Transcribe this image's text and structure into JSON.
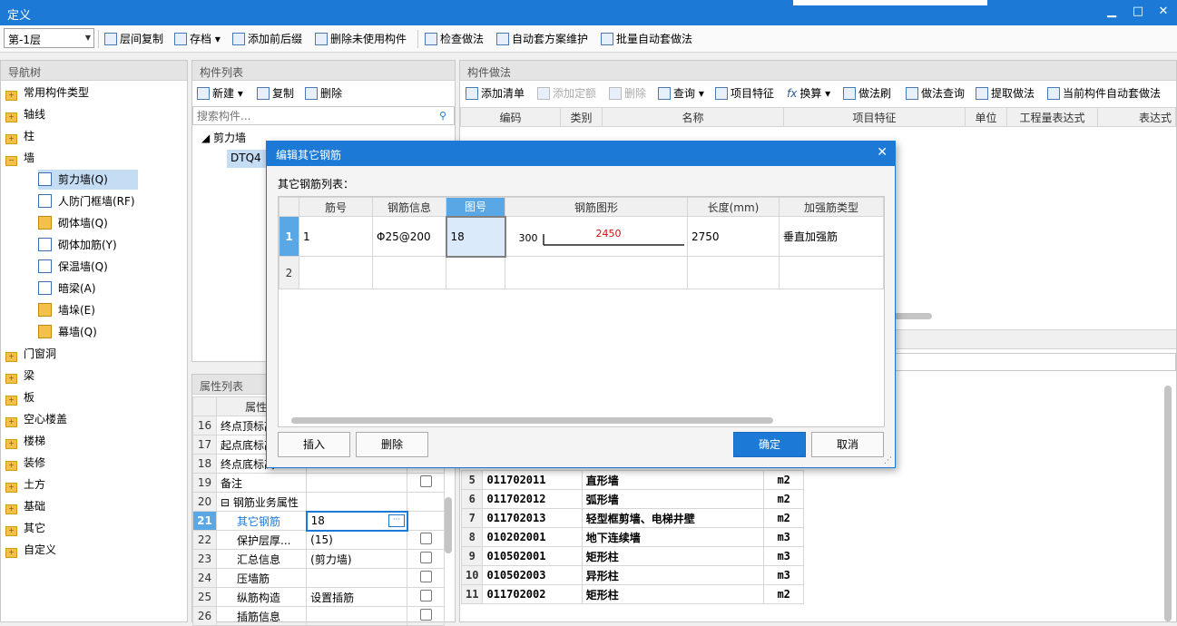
{
  "window": {
    "title": "定义"
  },
  "toolbar": {
    "floor": "第-1层",
    "items": [
      "层间复制",
      "存档",
      "添加前后缀",
      "删除未使用构件",
      "检查做法",
      "自动套方案维护",
      "批量自动套做法"
    ]
  },
  "nav": {
    "title": "导航树",
    "items": [
      "常用构件类型",
      "轴线",
      "柱",
      "墙",
      "梁",
      "板",
      "空心楼盖",
      "楼梯",
      "装修",
      "土方",
      "基础",
      "其它",
      "自定义"
    ],
    "door": "门窗洞",
    "wall_children": [
      "剪力墙(Q)",
      "人防门框墙(RF)",
      "砌体墙(Q)",
      "砌体加筋(Y)",
      "保温墙(Q)",
      "暗梁(A)",
      "墙垛(E)",
      "幕墙(Q)"
    ]
  },
  "complist": {
    "title": "构件列表",
    "new": "新建",
    "copy": "复制",
    "delete": "删除",
    "search_placeholder": "搜索构件...",
    "group": "剪力墙",
    "item": "DTQ4"
  },
  "props": {
    "title": "属性列表",
    "col": "属性名",
    "rows": [
      {
        "n": "16",
        "name": "终点顶标高",
        "val": "",
        "chk": false
      },
      {
        "n": "17",
        "name": "起点底标高",
        "val": "",
        "chk": false
      },
      {
        "n": "18",
        "name": "终点底标高",
        "val": "",
        "chk": false
      },
      {
        "n": "19",
        "name": "备注",
        "val": "",
        "chk": true
      },
      {
        "n": "20",
        "name": "钢筋业务属性",
        "val": "",
        "chk": null
      },
      {
        "n": "21",
        "name": "其它钢筋",
        "val": "18",
        "chk": null
      },
      {
        "n": "22",
        "name": "保护层厚...",
        "val": "(15)",
        "chk": true
      },
      {
        "n": "23",
        "name": "汇总信息",
        "val": "(剪力墙)",
        "chk": true
      },
      {
        "n": "24",
        "name": "压墙筋",
        "val": "",
        "chk": true
      },
      {
        "n": "25",
        "name": "纵筋构造",
        "val": "设置插筋",
        "chk": true
      },
      {
        "n": "26",
        "name": "插筋信息",
        "val": "",
        "chk": true
      }
    ]
  },
  "method": {
    "title": "构件做法",
    "tools": [
      "添加清单",
      "添加定额",
      "删除",
      "查询",
      "项目特征",
      "换算",
      "做法刷",
      "做法查询",
      "提取做法",
      "当前构件自动套做法"
    ],
    "cols": [
      "编码",
      "类别",
      "名称",
      "项目特征",
      "单位",
      "工程量表达式",
      "表达式"
    ]
  },
  "lower": {
    "rows": [
      {
        "n": "5",
        "code": "011702011",
        "name": "直形墙",
        "unit": "m2"
      },
      {
        "n": "6",
        "code": "011702012",
        "name": "弧形墙",
        "unit": "m2"
      },
      {
        "n": "7",
        "code": "011702013",
        "name": "轻型框剪墙、电梯井壁",
        "unit": "m2"
      },
      {
        "n": "8",
        "code": "010202001",
        "name": "地下连续墙",
        "unit": "m3"
      },
      {
        "n": "9",
        "code": "010502001",
        "name": "矩形柱",
        "unit": "m3"
      },
      {
        "n": "10",
        "code": "010502003",
        "name": "异形柱",
        "unit": "m3"
      },
      {
        "n": "11",
        "code": "011702002",
        "name": "矩形柱",
        "unit": "m2"
      }
    ]
  },
  "dialog": {
    "title": "编辑其它钢筋",
    "list_label": "其它钢筋列表：",
    "cols": [
      "筋号",
      "钢筋信息",
      "图号",
      "钢筋图形",
      "长度(mm)",
      "加强筋类型"
    ],
    "row1": {
      "n": "1",
      "no": "1",
      "info": "Φ25@200",
      "fig": "18",
      "dim_left": "300",
      "dim_top": "2450",
      "len": "2750",
      "type": "垂直加强筋"
    },
    "row2": {
      "n": "2"
    },
    "insert": "插入",
    "delete": "删除",
    "ok": "确定",
    "cancel": "取消"
  },
  "colors": {
    "accent": "#1c7ad6",
    "dim_red": "#d01010"
  }
}
